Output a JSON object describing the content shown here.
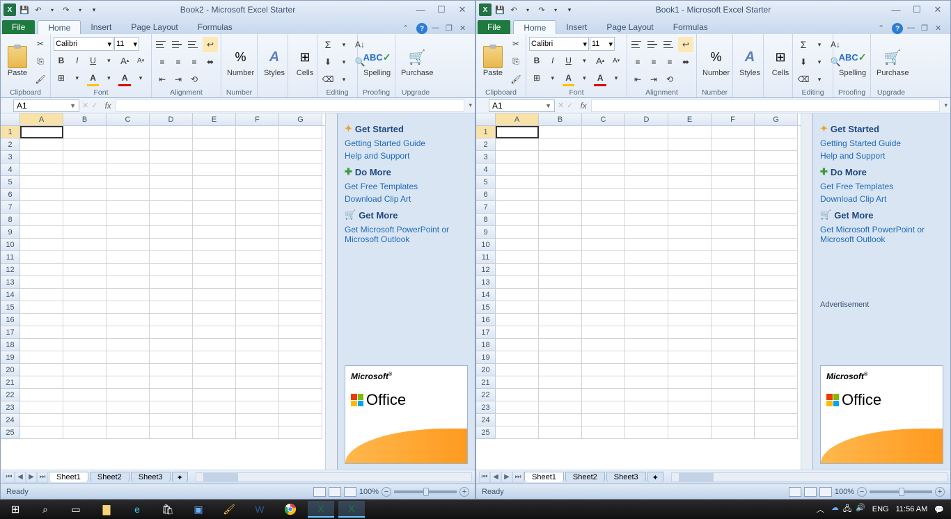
{
  "windows": [
    {
      "title": "Book2  -  Microsoft Excel Starter",
      "activeCell": "A1"
    },
    {
      "title": "Book1  -  Microsoft Excel Starter",
      "activeCell": "A1"
    }
  ],
  "qat": {
    "save": "💾",
    "undo": "↶",
    "redo": "↷"
  },
  "tabs": {
    "file": "File",
    "home": "Home",
    "insert": "Insert",
    "pageLayout": "Page Layout",
    "formulas": "Formulas"
  },
  "ribbon": {
    "clipboard": {
      "label": "Clipboard",
      "paste": "Paste"
    },
    "font": {
      "label": "Font",
      "name": "Calibri",
      "size": "11"
    },
    "alignment": {
      "label": "Alignment"
    },
    "number": {
      "label": "Number",
      "btn": "Number"
    },
    "styles": {
      "label": "Styles"
    },
    "cells": {
      "label": "Cells"
    },
    "editing": {
      "label": "Editing"
    },
    "proofing": {
      "label": "Proofing",
      "spelling": "Spelling"
    },
    "upgrade": {
      "label": "Upgrade",
      "purchase": "Purchase"
    }
  },
  "columns": [
    "A",
    "B",
    "C",
    "D",
    "E",
    "F",
    "G"
  ],
  "rowCount": 25,
  "side": {
    "getStarted": {
      "h": "Get Started",
      "links": [
        "Getting Started Guide",
        "Help and Support"
      ]
    },
    "doMore": {
      "h": "Do More",
      "links": [
        "Get Free Templates",
        "Download Clip Art"
      ]
    },
    "getMore": {
      "h": "Get More",
      "links": [
        "Get Microsoft PowerPoint or Microsoft Outlook"
      ]
    },
    "adLabel": "Advertisement",
    "adMicrosoft": "Microsoft",
    "adOffice": "Office"
  },
  "sheets": [
    "Sheet1",
    "Sheet2",
    "Sheet3"
  ],
  "status": {
    "ready": "Ready",
    "zoom": "100%"
  },
  "taskbar": {
    "lang": "ENG",
    "time": "11:56 AM"
  }
}
